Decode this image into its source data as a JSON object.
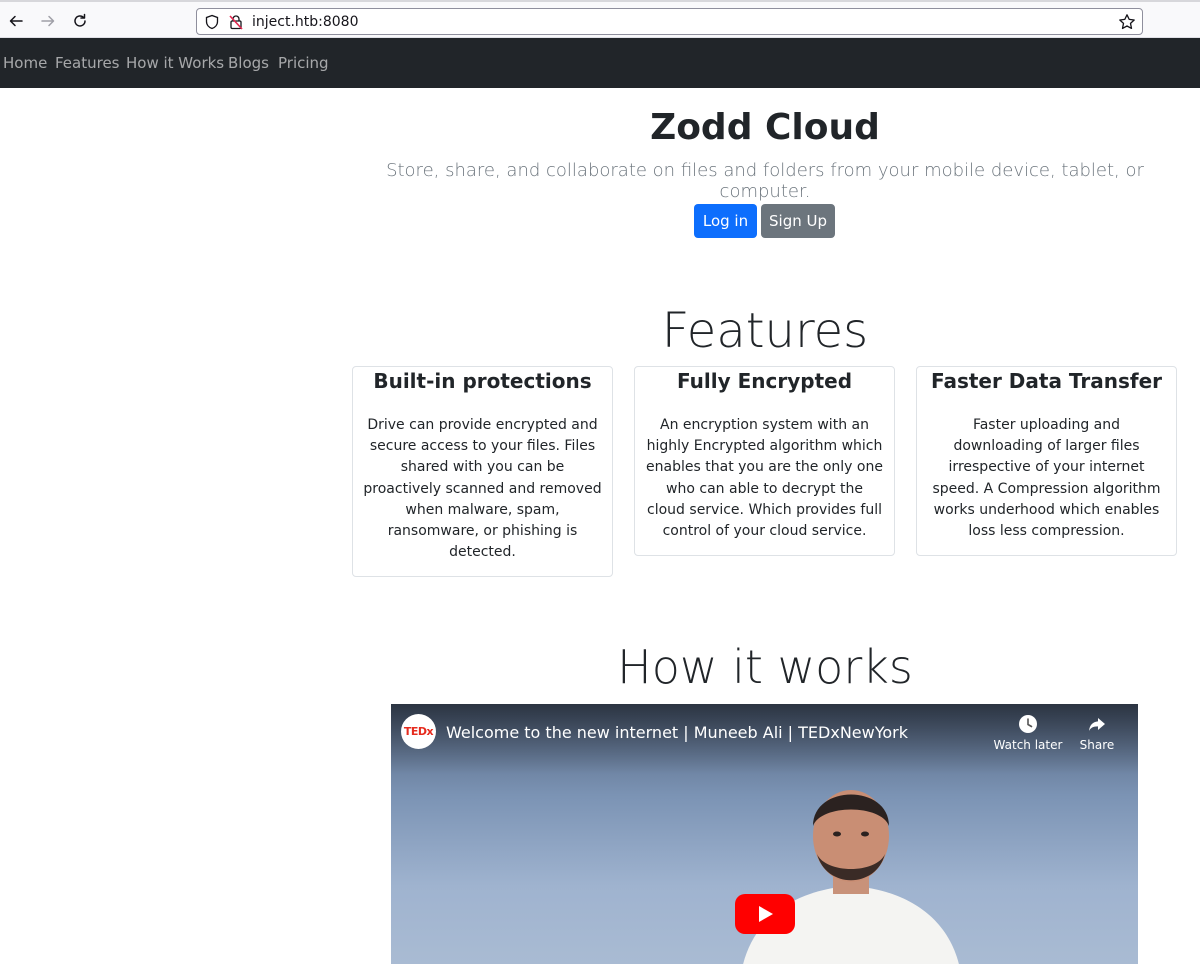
{
  "browser": {
    "url": "inject.htb:8080"
  },
  "nav": {
    "items": [
      {
        "label": "Home"
      },
      {
        "label": "Features"
      },
      {
        "label": "How it Works"
      },
      {
        "label": "Blogs"
      },
      {
        "label": "Pricing"
      }
    ]
  },
  "hero": {
    "title": "Zodd Cloud",
    "subtitle": "Store, share, and collaborate on files and folders from your mobile device, tablet, or computer.",
    "login_label": "Log in",
    "signup_label": "Sign Up"
  },
  "features": {
    "title": "Features",
    "cards": [
      {
        "title": "Built-in protections",
        "text": "Drive can provide encrypted and secure access to your files. Files shared with you can be proactively scanned and removed when malware, spam, ransomware, or phishing is detected."
      },
      {
        "title": "Fully Encrypted",
        "text": "An encryption system with an highly Encrypted algorithm which enables that you are the only one who can able to decrypt the cloud service. Which provides full control of your cloud service."
      },
      {
        "title": "Faster Data Transfer",
        "text": "Faster uploading and downloading of larger files irrespective of your internet speed. A Compression algorithm works underhood which enables loss less compression."
      }
    ]
  },
  "how": {
    "title": "How it works",
    "video": {
      "channel_logo": "TEDx",
      "title": "Welcome to the new internet | Muneeb Ali | TEDxNewYork",
      "watch_later": "Watch later",
      "share": "Share"
    }
  },
  "colors": {
    "navbar_bg": "#212529",
    "primary": "#0d6efd",
    "secondary": "#6c757d",
    "youtube_red": "#ff0000"
  },
  "icons": [
    "back-arrow-icon",
    "forward-arrow-icon",
    "reload-icon",
    "shield-icon",
    "insecure-lock-icon",
    "bookmark-star-icon",
    "clock-icon",
    "share-arrow-icon",
    "youtube-play-icon"
  ]
}
